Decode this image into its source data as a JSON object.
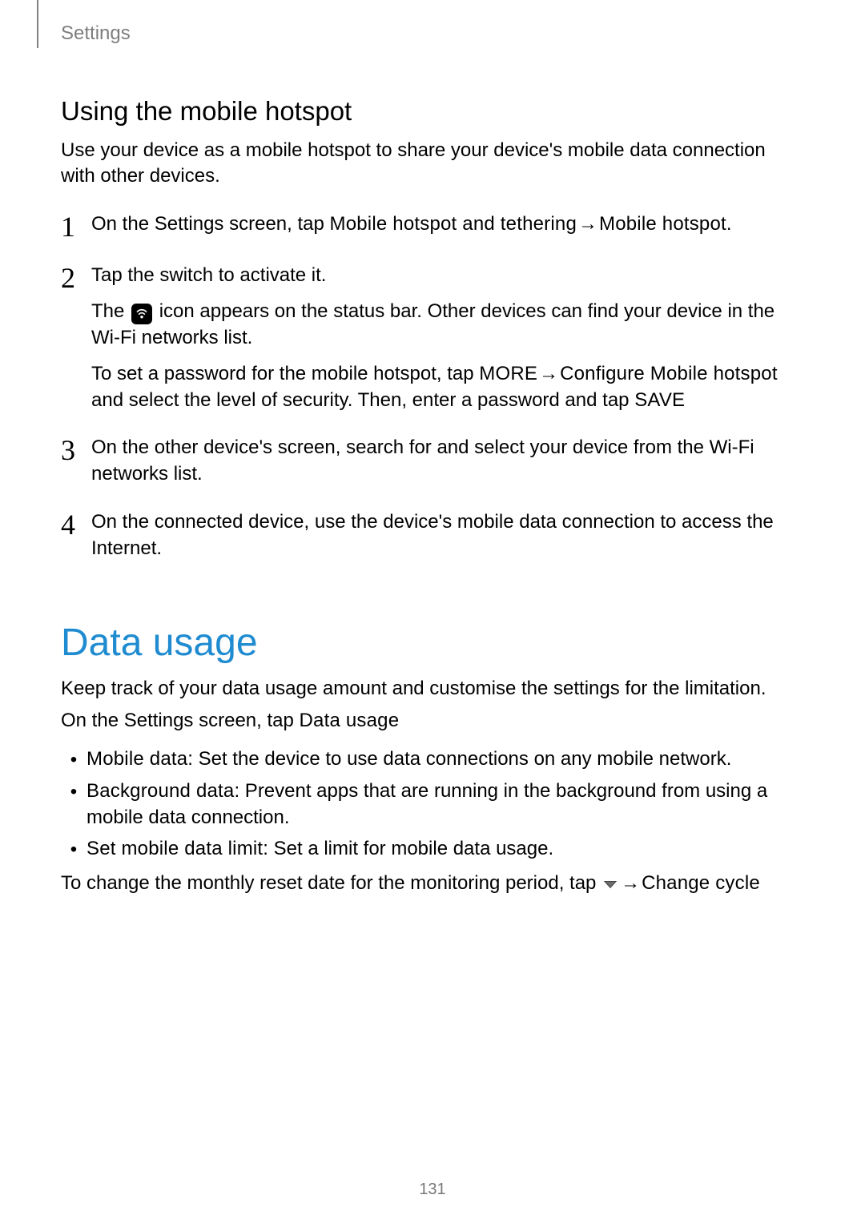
{
  "header": {
    "tab": "Settings"
  },
  "hotspot": {
    "title": "Using the mobile hotspot",
    "intro": "Use your device as a mobile hotspot to share your device's mobile data connection with other devices.",
    "steps": {
      "s1_num": "1",
      "s1_a": "On the Settings screen, tap ",
      "s1_b": "Mobile hotspot and tethering",
      "s1_arrow": " → ",
      "s1_c": "Mobile hotspot",
      "s1_d": ".",
      "s2_num": "2",
      "s2_a": "Tap the switch to activate it.",
      "s2_sub1_a": "The ",
      "s2_sub1_b": " icon appears on the status bar. Other devices can find your device in the Wi-Fi networks list.",
      "s2_sub2_a": "To set a password for the mobile hotspot, tap ",
      "s2_sub2_b": "MORE",
      "s2_sub2_arrow": "→ ",
      "s2_sub2_c": "Configure Mobile hotspot",
      "s2_sub2_d": " and select the level of security. Then, enter a password and tap ",
      "s2_sub2_e": "SAVE",
      "s3_num": "3",
      "s3_a": "On the other device's screen, search for and select your device from the Wi-Fi networks list.",
      "s4_num": "4",
      "s4_a": "On the connected device, use the device's mobile data connection to access the Internet."
    }
  },
  "data_usage": {
    "title": "Data usage",
    "p1": "Keep track of your data usage amount and customise the settings for the limitation.",
    "p2_a": "On the Settings screen, tap ",
    "p2_b": "Data usage",
    "bullets": {
      "b1_label": "Mobile data",
      "b1_text": ": Set the device to use data connections on any mobile network.",
      "b2_label": "Background data",
      "b2_text": ": Prevent apps that are running in the background from using a mobile data connection.",
      "b3_label": "Set mobile data limit",
      "b3_text": ": Set a limit for mobile data usage."
    },
    "p3_a": "To change the monthly reset date for the monitoring period, tap ",
    "p3_arrow": " → ",
    "p3_b": "Change cycle"
  },
  "page_number": "131",
  "bullet_char": "•"
}
